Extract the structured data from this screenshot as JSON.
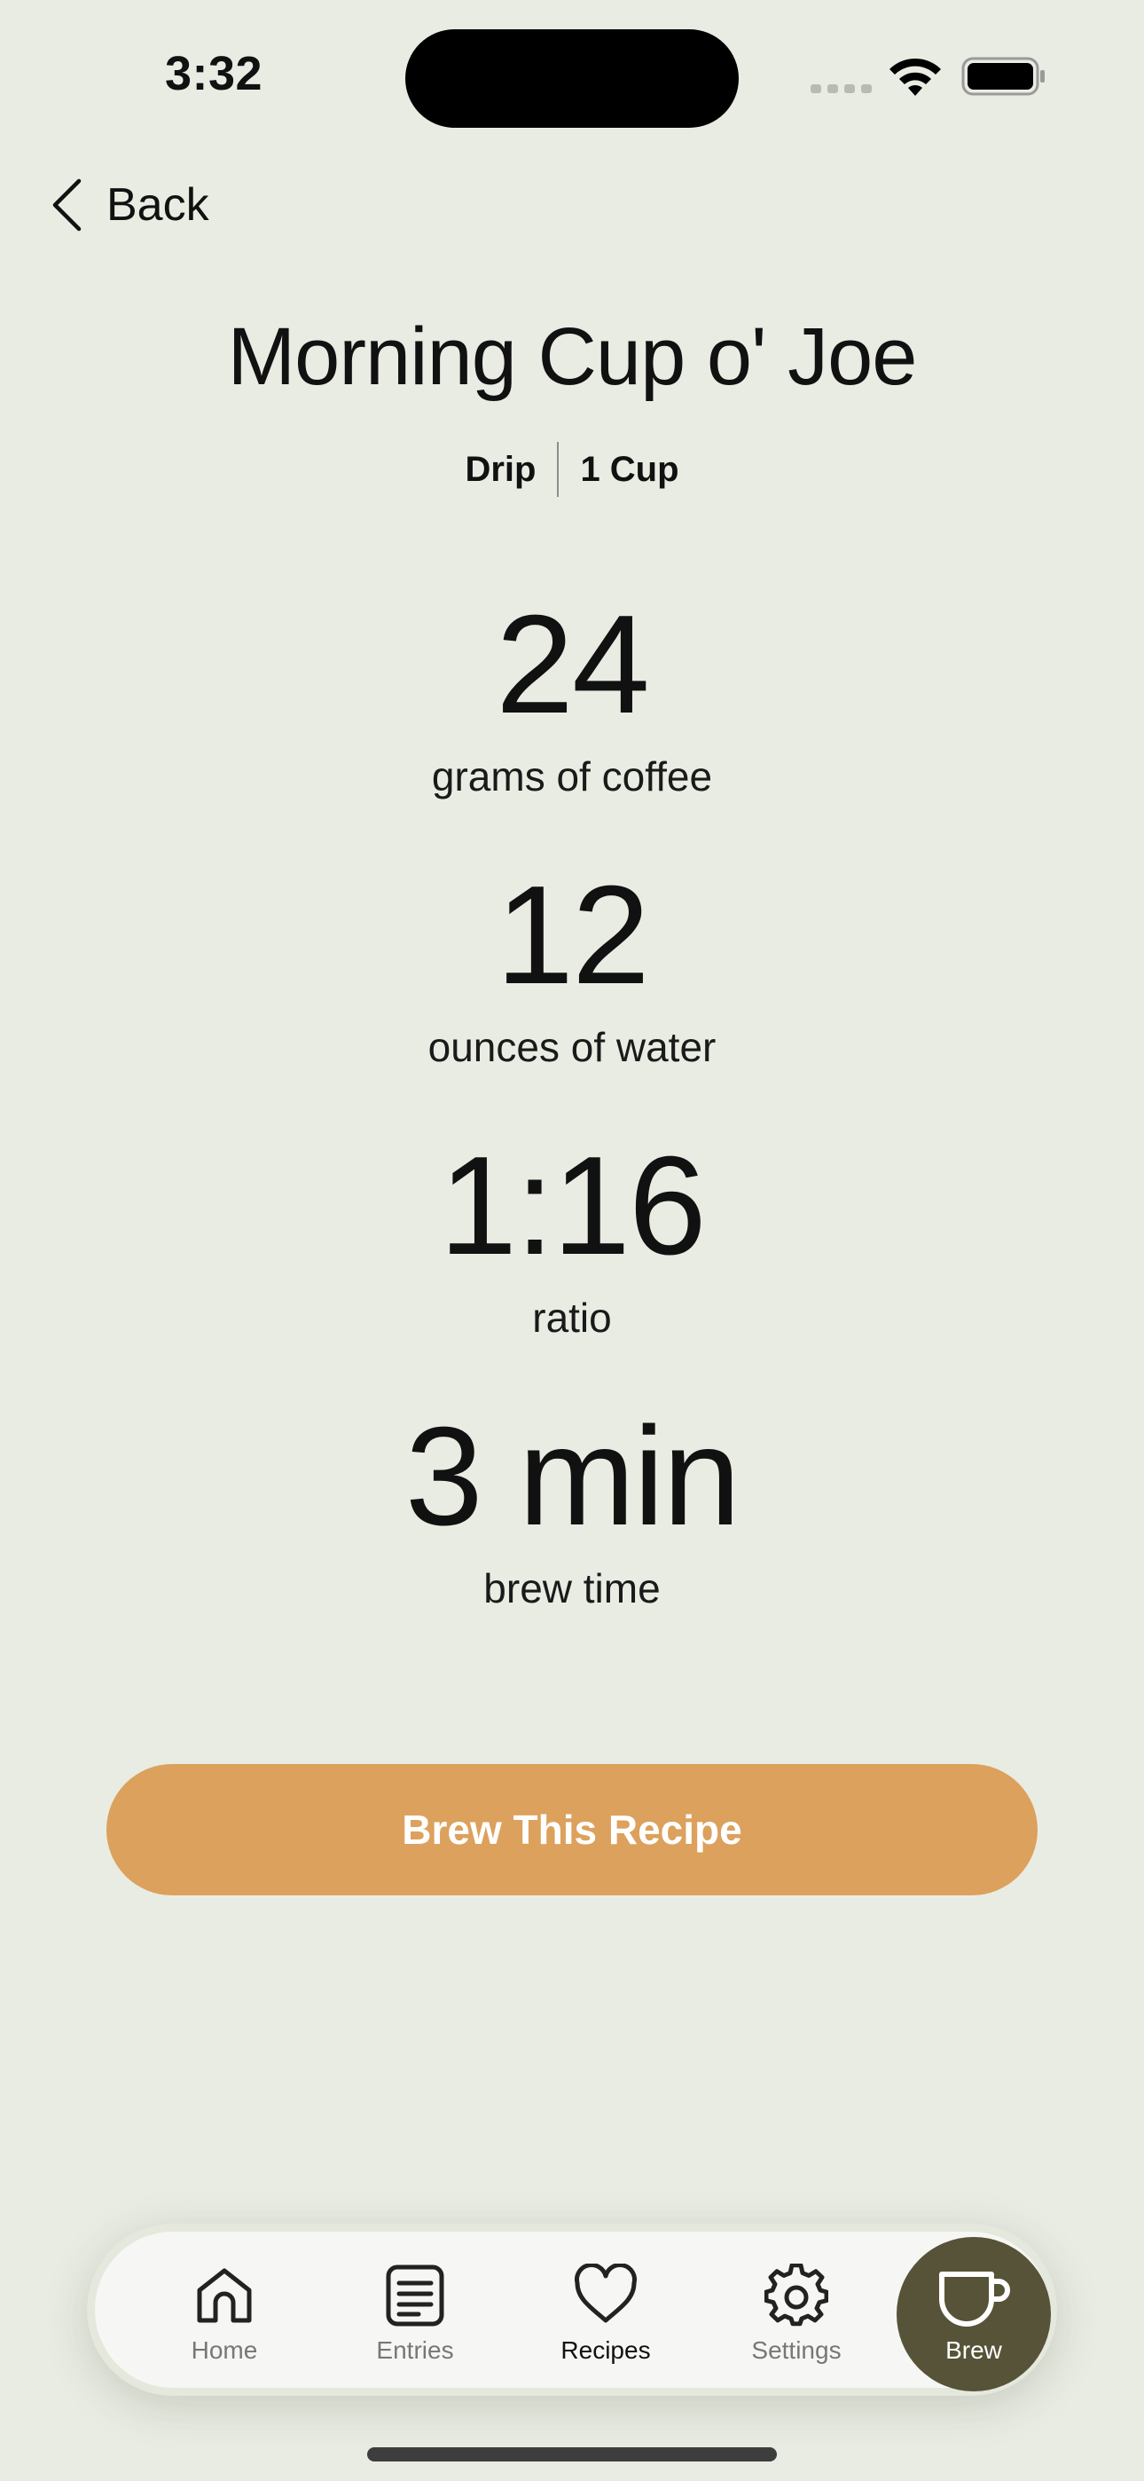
{
  "status_bar": {
    "time": "3:32"
  },
  "nav": {
    "back_label": "Back"
  },
  "recipe": {
    "title": "Morning Cup o' Joe",
    "method": "Drip",
    "size": "1 Cup",
    "stats": [
      {
        "value": "24",
        "label": "grams of coffee"
      },
      {
        "value": "12",
        "label": "ounces of water"
      },
      {
        "value": "1:16",
        "label": "ratio"
      },
      {
        "value": "3 min",
        "label": "brew time"
      }
    ]
  },
  "actions": {
    "brew_label": "Brew This Recipe",
    "accent_color": "#dca15c"
  },
  "tabbar": {
    "items": [
      {
        "label": "Home",
        "icon": "home-icon"
      },
      {
        "label": "Entries",
        "icon": "entries-icon"
      },
      {
        "label": "Recipes",
        "icon": "heart-icon"
      },
      {
        "label": "Settings",
        "icon": "gear-icon"
      }
    ],
    "active": "Recipes",
    "brew": {
      "label": "Brew",
      "icon": "cup-icon",
      "color": "#565338"
    }
  }
}
